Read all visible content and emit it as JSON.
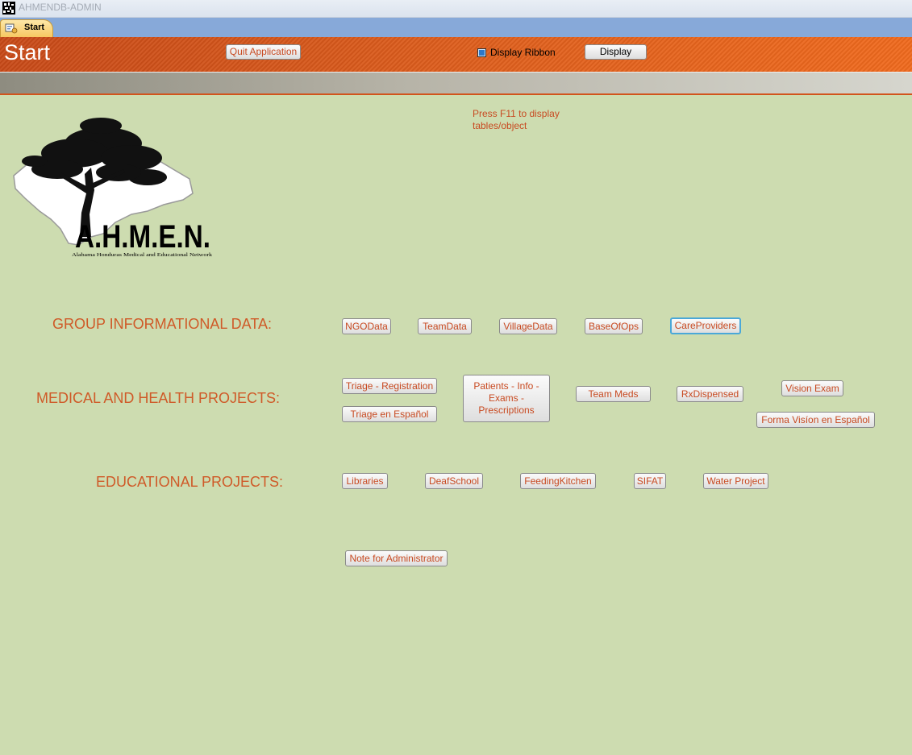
{
  "window": {
    "title": "AHMENDB-ADMIN"
  },
  "tabs": [
    {
      "label": "Start"
    }
  ],
  "header": {
    "title": "Start",
    "quit_label": "Quit Application",
    "display_ribbon_label": "Display Ribbon",
    "display_label": "Display"
  },
  "note": "Press F11 to display tables/object",
  "logo": {
    "text": "A.H.M.E.N.",
    "subtitle": "Alabama Honduras Medical and Educational Network"
  },
  "sections": {
    "group": {
      "label": "GROUP INFORMATIONAL DATA:",
      "buttons": [
        "NGOData",
        "TeamData",
        "VillageData",
        "BaseOfOps",
        "CareProviders"
      ]
    },
    "medical": {
      "label": "MEDICAL AND HEALTH PROJECTS:",
      "buttons": [
        "Triage - Registration",
        "Triage en Español",
        "Patients - Info - Exams - Prescriptions",
        "Team Meds",
        "RxDispensed",
        "Vision Exam",
        "Forma Visíon en Español"
      ]
    },
    "educational": {
      "label": "EDUCATIONAL PROJECTS:",
      "buttons": [
        "Libraries",
        "DeafSchool",
        "FeedingKitchen",
        "SIFAT",
        "Water Project"
      ]
    }
  },
  "admin": {
    "note_label": "Note for Administrator"
  },
  "colors": {
    "accent": "#c84a21",
    "background": "#cddcb0",
    "ribbon": "#e0601d",
    "tabstrip": "#87a9d9"
  }
}
